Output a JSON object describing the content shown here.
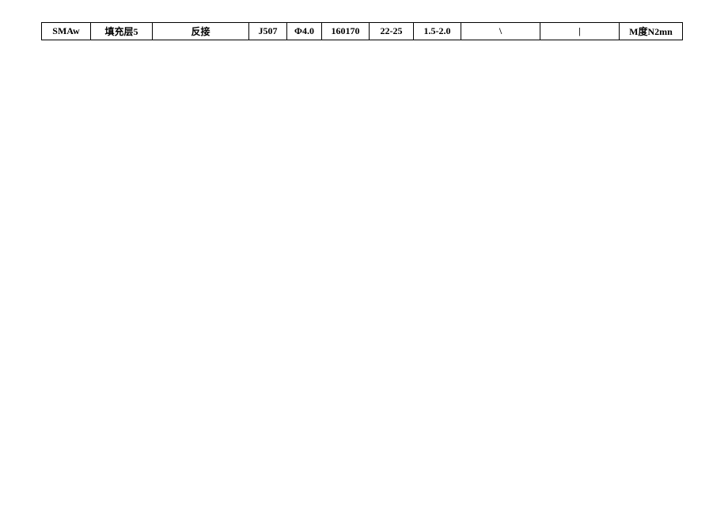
{
  "table": {
    "rows": [
      {
        "cells": [
          "SMAw",
          "填充层5",
          "反接",
          "J507",
          "Φ4.0",
          "160170",
          "22-25",
          "1.5-2.0",
          "\\",
          "|",
          "M度N2mn"
        ]
      }
    ]
  }
}
